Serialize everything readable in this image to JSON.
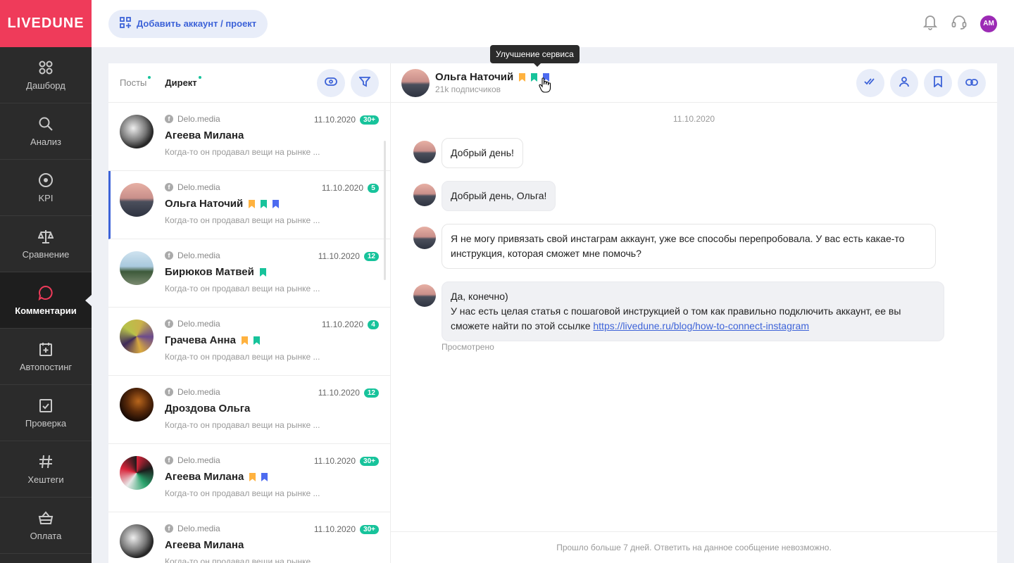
{
  "brand": "LIVEDUNE",
  "sidebar": {
    "items": [
      {
        "label": "Дашборд",
        "icon": "dashboard-icon"
      },
      {
        "label": "Анализ",
        "icon": "search-icon"
      },
      {
        "label": "KPI",
        "icon": "target-icon"
      },
      {
        "label": "Сравнение",
        "icon": "scales-icon"
      },
      {
        "label": "Комментарии",
        "icon": "comment-icon",
        "active": true
      },
      {
        "label": "Автопостинг",
        "icon": "calendar-plus-icon"
      },
      {
        "label": "Проверка",
        "icon": "check-calendar-icon"
      },
      {
        "label": "Хештеги",
        "icon": "hashtag-icon"
      },
      {
        "label": "Оплата",
        "icon": "basket-icon"
      }
    ]
  },
  "topbar": {
    "add_label": "Добавить аккаунт / проект",
    "avatar_initials": "AM"
  },
  "list": {
    "tabs": [
      {
        "label": "Посты"
      },
      {
        "label": "Директ",
        "active": true
      }
    ],
    "items": [
      {
        "source": "Delo.media",
        "date": "11.10.2020",
        "badge": "30+",
        "name": "Агеева Милана",
        "snippet": "Когда-то он продавал вещи на рынке ...",
        "bookmarks": []
      },
      {
        "source": "Delo.media",
        "date": "11.10.2020",
        "badge": "5",
        "name": "Ольга Наточий",
        "snippet": "Когда-то он продавал вещи на рынке ...",
        "bookmarks": [
          "orange",
          "green",
          "blue"
        ],
        "selected": true
      },
      {
        "source": "Delo.media",
        "date": "11.10.2020",
        "badge": "12",
        "name": "Бирюков Матвей",
        "snippet": "Когда-то он продавал вещи на рынке ...",
        "bookmarks": [
          "green"
        ]
      },
      {
        "source": "Delo.media",
        "date": "11.10.2020",
        "badge": "4",
        "name": "Грачева Анна",
        "snippet": "Когда-то он продавал вещи на рынке ...",
        "bookmarks": [
          "orange",
          "green"
        ]
      },
      {
        "source": "Delo.media",
        "date": "11.10.2020",
        "badge": "12",
        "name": "Дроздова Ольга",
        "snippet": "Когда-то он продавал вещи на рынке ...",
        "bookmarks": []
      },
      {
        "source": "Delo.media",
        "date": "11.10.2020",
        "badge": "30+",
        "name": "Агеева Милана",
        "snippet": "Когда-то он продавал вещи на рынке ...",
        "bookmarks": [
          "orange",
          "blue"
        ]
      },
      {
        "source": "Delo.media",
        "date": "11.10.2020",
        "badge": "30+",
        "name": "Агеева Милана",
        "snippet": "Когда-то он продавал вещи на рынке ...",
        "bookmarks": []
      }
    ]
  },
  "chat": {
    "name": "Ольга Наточий",
    "followers": "21k подписчиков",
    "date": "11.10.2020",
    "messages": [
      {
        "text": "Добрый день!"
      },
      {
        "text": "Добрый день, Ольга!"
      },
      {
        "text": "Я не могу привязать свой инстаграм аккаунт, уже все способы перепробовала. У вас есть какае-то инструкция, которая сможет мне помочь?"
      },
      {
        "line1": "Да, конечно)",
        "line2": "У нас есть целая статья с пошаговой инструкцией о том как правильно подключить аккаунт, ее вы сможете найти по этой ссылке ",
        "link": "https://livedune.ru/blog/how-to-connect-instagram"
      }
    ],
    "seen": "Просмотрено",
    "footer": "Прошло больше 7 дней. Ответить на данное сообщение невозможно."
  },
  "tooltip": "Улучшение сервиса",
  "colors": {
    "brand": "#ef3b5a",
    "accent": "#3d63d8",
    "green": "#17c39b",
    "orange": "#ffb23f",
    "blue": "#4d6bf0"
  }
}
